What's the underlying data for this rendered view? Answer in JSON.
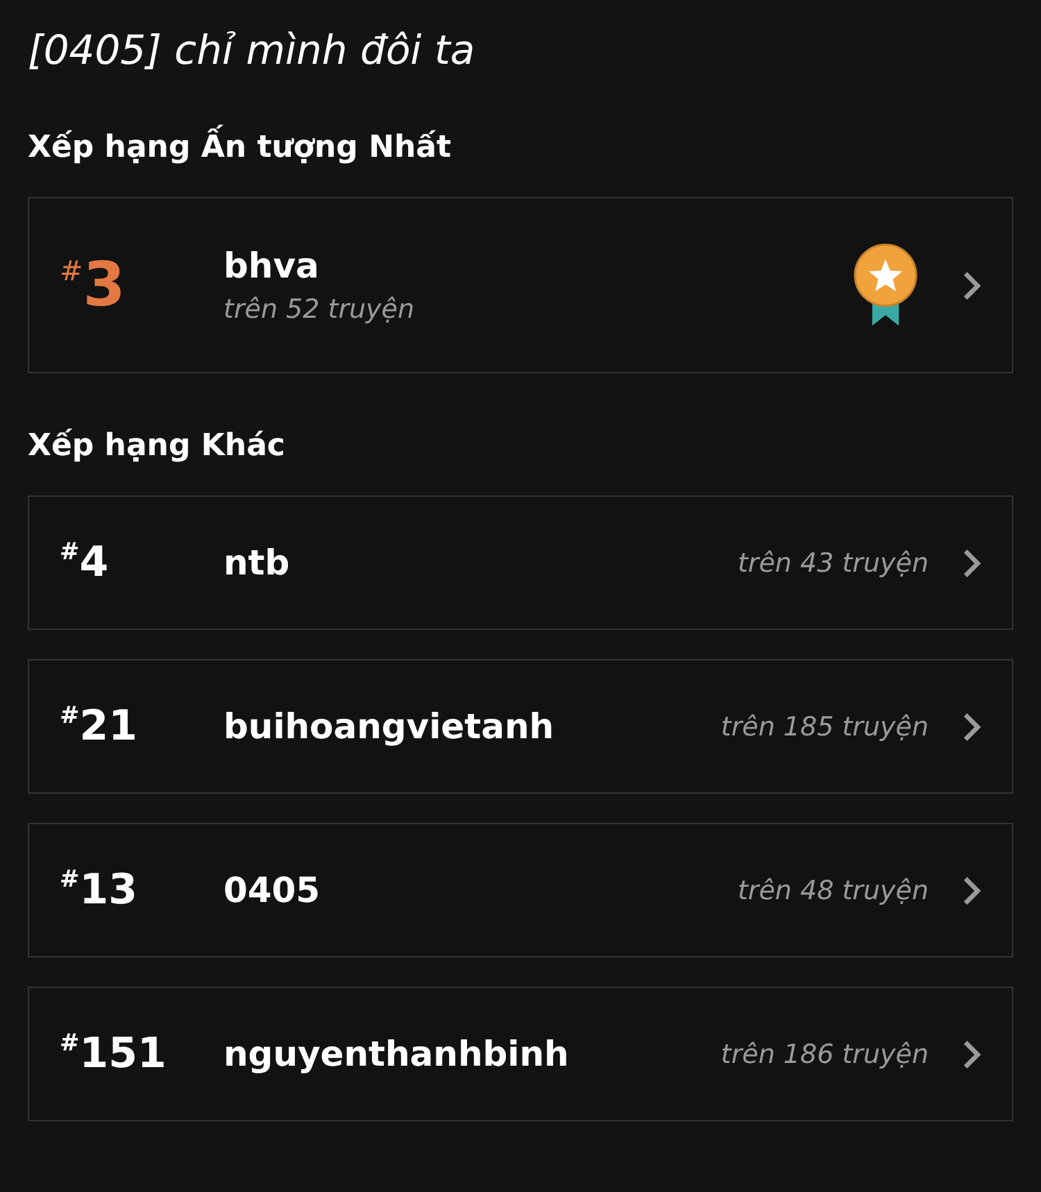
{
  "title": "[0405] chỉ mình đôi ta",
  "sections": [
    {
      "heading": "Xếp hạng Ấn tượng Nhất",
      "kind": "featured",
      "rows": [
        {
          "rank": "$^{#}$3",
          "name": "bhva",
          "count": "trên 52 truyện"
        }
      ]
    },
    {
      "heading": "Xếp hạng Khác",
      "kind": "standard",
      "rows": [
        {
          "rank": "$^{#}$4",
          "name": "ntb",
          "count": "trên 43 truyện"
        },
        {
          "rank": "$^{#}$21",
          "name": "buihoangvietanh",
          "count": "trên 185 truyện"
        },
        {
          "rank": "$^{#}$13",
          "name": "0405",
          "count": "trên 48 truyện"
        },
        {
          "rank": "$^{#}$151",
          "name": "nguyenthanhbinh",
          "count": "trên 186 truyện"
        }
      ]
    }
  ]
}
